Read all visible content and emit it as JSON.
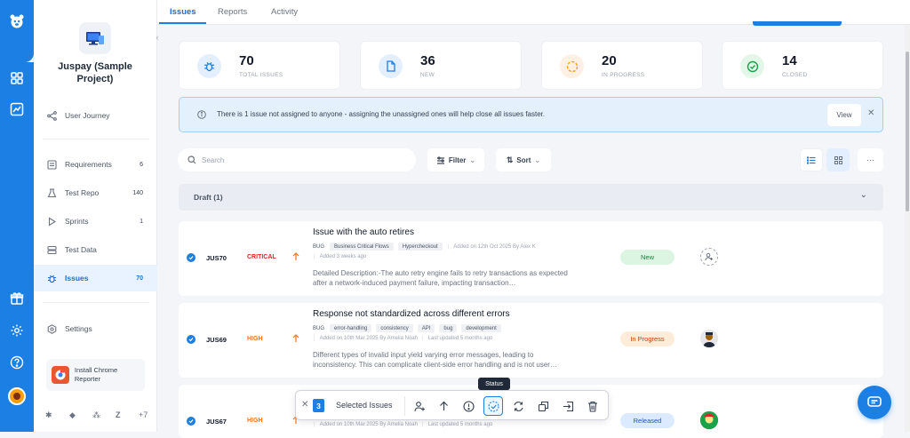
{
  "sidebar": {
    "project_name": "Juspay (Sample Project)",
    "items": [
      {
        "label": "User Journey",
        "count": ""
      },
      {
        "label": "Requirements",
        "count": "6"
      },
      {
        "label": "Test Repo",
        "count": "140"
      },
      {
        "label": "Sprints",
        "count": "1"
      },
      {
        "label": "Test Data",
        "count": ""
      },
      {
        "label": "Issues",
        "count": "70"
      },
      {
        "label": "Settings",
        "count": ""
      }
    ],
    "chrome_card": "Install Chrome Reporter",
    "integrations_more": "+7"
  },
  "tabs": [
    "Issues",
    "Reports",
    "Activity"
  ],
  "stats": [
    {
      "value": "70",
      "label": "TOTAL ISSUES",
      "color": "#1b7fe3"
    },
    {
      "value": "36",
      "label": "NEW",
      "color": "#1b7fe3"
    },
    {
      "value": "20",
      "label": "IN PROGRESS",
      "color": "#f59e0b"
    },
    {
      "value": "14",
      "label": "CLOSED",
      "color": "#16a34a"
    }
  ],
  "banner": {
    "message": "There is 1 issue not assigned to anyone - assigning the unassigned ones will help close all issues faster.",
    "view_label": "View"
  },
  "toolbar": {
    "search_placeholder": "Search",
    "filter_label": "Filter",
    "sort_label": "Sort"
  },
  "draft_group": "Draft (1)",
  "issues": [
    {
      "id": "JUS70",
      "priority": "CRITICAL",
      "priority_color": "#dc2626",
      "title": "Issue with the auto retires",
      "type": "BUG",
      "tags": [
        "Business Critical Flows",
        "Hypercheckout"
      ],
      "meta1": "Added on 12th Oct 2025 By Alex K",
      "meta2": "Added 3 weeks ago",
      "desc": "Detailed Description:-The auto retry engine fails to retry transactions as expected after a network-induced payment failure, impacting transaction…",
      "status": "New",
      "status_bg": "#dcf5e3",
      "status_fg": "#15803d"
    },
    {
      "id": "JUS69",
      "priority": "HIGH",
      "priority_color": "#f97316",
      "title": "Response not standardized across different errors",
      "type": "BUG",
      "tags": [
        "error-handling",
        "consistency",
        "API",
        "bug",
        "development"
      ],
      "meta1": "Added on 10th Mar 2025 By Amelia Noah",
      "meta2": "Last updated 5 months ago",
      "desc": "Different types of invalid input yield varying error messages, leading to inconsistency. This can complicate client-side error handling and is not user…",
      "status": "In Progress",
      "status_bg": "#fdecd8",
      "status_fg": "#c2410c"
    },
    {
      "id": "JUS67",
      "priority": "HIGH",
      "priority_color": "#f97316",
      "meta1": "Added on 10th Mar 2025 By Amelia Noah",
      "meta2": "Last updated 5 months ago",
      "status": "Released",
      "status_bg": "#dbeafe",
      "status_fg": "#1d4ed8"
    }
  ],
  "bulk_bar": {
    "count": "3",
    "label": "Selected Issues",
    "tooltip": "Status"
  }
}
